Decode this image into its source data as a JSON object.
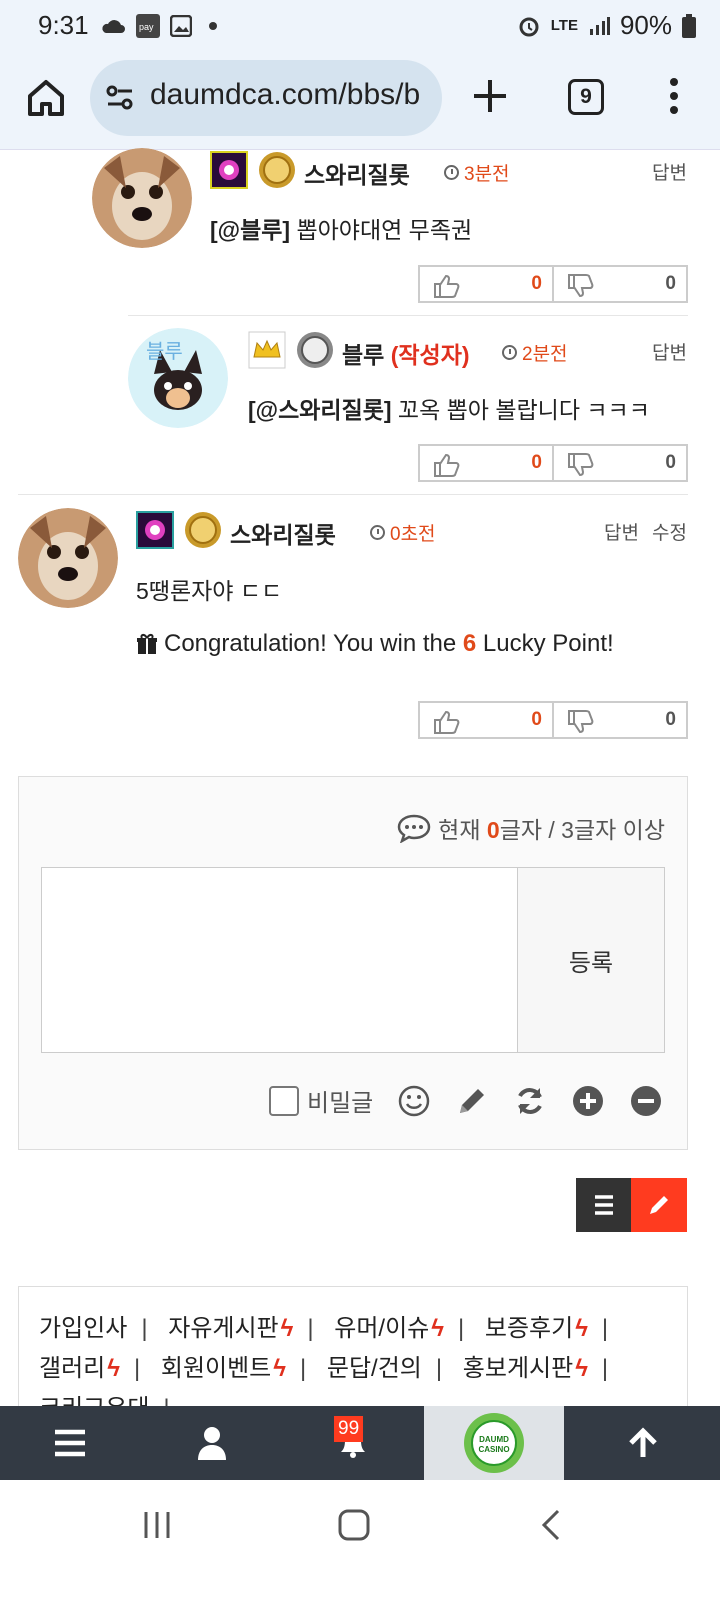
{
  "status": {
    "time": "9:31",
    "battery": "90%",
    "network": "LTE"
  },
  "browser": {
    "url": "daumdca.com/bbs/b",
    "tab_count": "9"
  },
  "comments": [
    {
      "nick": "스와리질롯",
      "ago": "3분전",
      "reply": "답변",
      "mention": "[@블루]",
      "text": " 뽑아야대연  무족권",
      "up": "0",
      "down": "0"
    },
    {
      "nick": "블루",
      "author": "(작성자)",
      "ago": "2분전",
      "reply": "답변",
      "mention": "[@스와리질롯]",
      "text": " 꼬옥 뽑아 볼랍니다 ㅋㅋㅋ",
      "up": "0",
      "down": "0"
    },
    {
      "nick": "스와리질롯",
      "ago": "0초전",
      "reply": "답변",
      "edit": "수정",
      "text": "5땡론자야 ㄷㄷ",
      "lucky_pre": "Congratulation! You win the ",
      "lucky_num": "6",
      "lucky_post": " Lucky Point!",
      "up": "0",
      "down": "0"
    }
  ],
  "write": {
    "counter_pre": "현재 ",
    "counter_num": "0",
    "counter_post": "글자 / 3글자 이상",
    "submit": "등록",
    "secret": "비밀글"
  },
  "menu": {
    "items": [
      {
        "label": "가입인사",
        "hot": false
      },
      {
        "label": "자유게시판",
        "hot": true
      },
      {
        "label": "유머/이슈",
        "hot": true
      },
      {
        "label": "보증후기",
        "hot": true
      },
      {
        "label": "갤러리",
        "hot": true
      },
      {
        "label": "회원이벤트",
        "hot": true
      },
      {
        "label": "문답/건의",
        "hot": false
      },
      {
        "label": "홍보게시판",
        "hot": true
      },
      {
        "label": "크리교유대",
        "hot": false
      }
    ],
    "separator": "|"
  },
  "bottom": {
    "notif_count": "99",
    "logo_text": "DAUMD CASINO"
  },
  "icons": {
    "bolt": "ϟ",
    "gift": "gift-icon",
    "clock": "clock-icon"
  }
}
